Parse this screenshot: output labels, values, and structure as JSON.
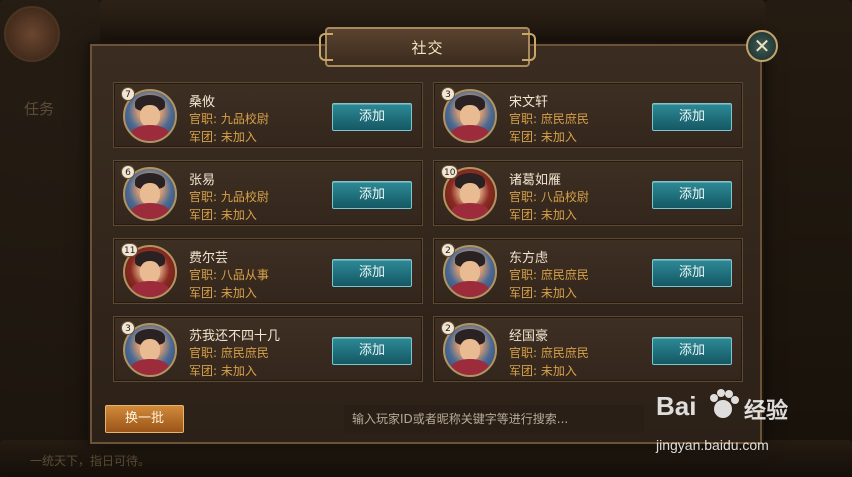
{
  "dialog": {
    "title": "社交",
    "close_icon": "close-icon"
  },
  "players": [
    {
      "level": "7",
      "name": "桑攸",
      "rank_label": "官职:",
      "rank": "九品校尉",
      "legion_label": "军团:",
      "legion": "未加入",
      "button": "添加",
      "portrait": "male"
    },
    {
      "level": "3",
      "name": "宋文轩",
      "rank_label": "官职:",
      "rank": "庶民庶民",
      "legion_label": "军团:",
      "legion": "未加入",
      "button": "添加",
      "portrait": "male"
    },
    {
      "level": "6",
      "name": "张易",
      "rank_label": "官职:",
      "rank": "九品校尉",
      "legion_label": "军团:",
      "legion": "未加入",
      "button": "添加",
      "portrait": "male"
    },
    {
      "level": "10",
      "name": "诸葛如雁",
      "rank_label": "官职:",
      "rank": "八品校尉",
      "legion_label": "军团:",
      "legion": "未加入",
      "button": "添加",
      "portrait": "female"
    },
    {
      "level": "11",
      "name": "费尔芸",
      "rank_label": "官职:",
      "rank": "八品从事",
      "legion_label": "军团:",
      "legion": "未加入",
      "button": "添加",
      "portrait": "female"
    },
    {
      "level": "2",
      "name": "东方虑",
      "rank_label": "官职:",
      "rank": "庶民庶民",
      "legion_label": "军团:",
      "legion": "未加入",
      "button": "添加",
      "portrait": "male"
    },
    {
      "level": "3",
      "name": "苏我还不四十几",
      "rank_label": "官职:",
      "rank": "庶民庶民",
      "legion_label": "军团:",
      "legion": "未加入",
      "button": "添加",
      "portrait": "male"
    },
    {
      "level": "2",
      "name": "经国豪",
      "rank_label": "官职:",
      "rank": "庶民庶民",
      "legion_label": "军团:",
      "legion": "未加入",
      "button": "添加",
      "portrait": "male"
    }
  ],
  "footer": {
    "refresh_label": "换一批",
    "search_placeholder": "输入玩家ID或者昵称关键字等进行搜索..."
  },
  "background": {
    "task_label": "任务",
    "chat_line": "一统天下，指日可待。"
  },
  "watermark": {
    "logo": "Bai",
    "cn": "经验",
    "url": "jingyan.baidu.com"
  },
  "colors": {
    "accent_gold": "#d8a24a",
    "button_teal": "#2d8a96",
    "button_orange": "#d18a3a"
  }
}
